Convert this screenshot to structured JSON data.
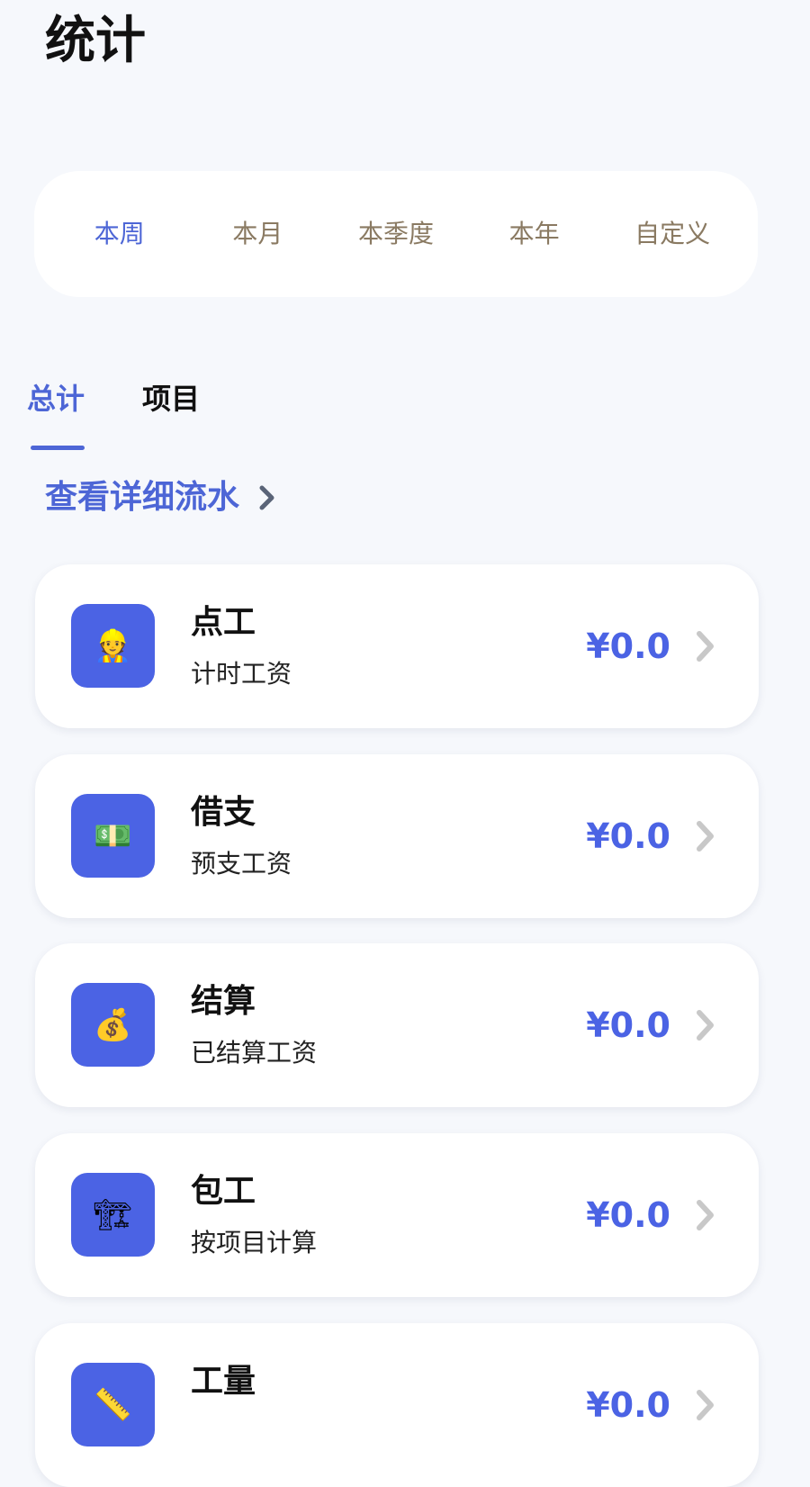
{
  "header": {
    "title": "统计"
  },
  "periods": [
    {
      "label": "本周",
      "active": true
    },
    {
      "label": "本月",
      "active": false
    },
    {
      "label": "本季度",
      "active": false
    },
    {
      "label": "本年",
      "active": false
    },
    {
      "label": "自定义",
      "active": false
    }
  ],
  "tabs": {
    "total": "总计",
    "project": "项目",
    "active": "total"
  },
  "detail_link": {
    "label": "查看详细流水"
  },
  "cards": [
    {
      "icon": "construction-worker-icon",
      "glyph": "👷",
      "title": "点工",
      "subtitle": "计时工资",
      "amount": "¥0.0"
    },
    {
      "icon": "money-banknote-icon",
      "glyph": "💵",
      "title": "借支",
      "subtitle": "预支工资",
      "amount": "¥0.0"
    },
    {
      "icon": "money-bag-icon",
      "glyph": "💰",
      "title": "结算",
      "subtitle": "已结算工资",
      "amount": "¥0.0"
    },
    {
      "icon": "crane-icon",
      "glyph": "🏗",
      "title": "包工",
      "subtitle": "按项目计算",
      "amount": "¥0.0"
    },
    {
      "icon": "ruler-icon",
      "glyph": "📏",
      "title": "工量",
      "subtitle": "",
      "amount": "¥0.0"
    }
  ],
  "colors": {
    "accent": "#4d66d6",
    "icon_bg": "#4b63e4",
    "inactive_period": "#8a7a62",
    "page_bg": "#f6f8fc"
  }
}
